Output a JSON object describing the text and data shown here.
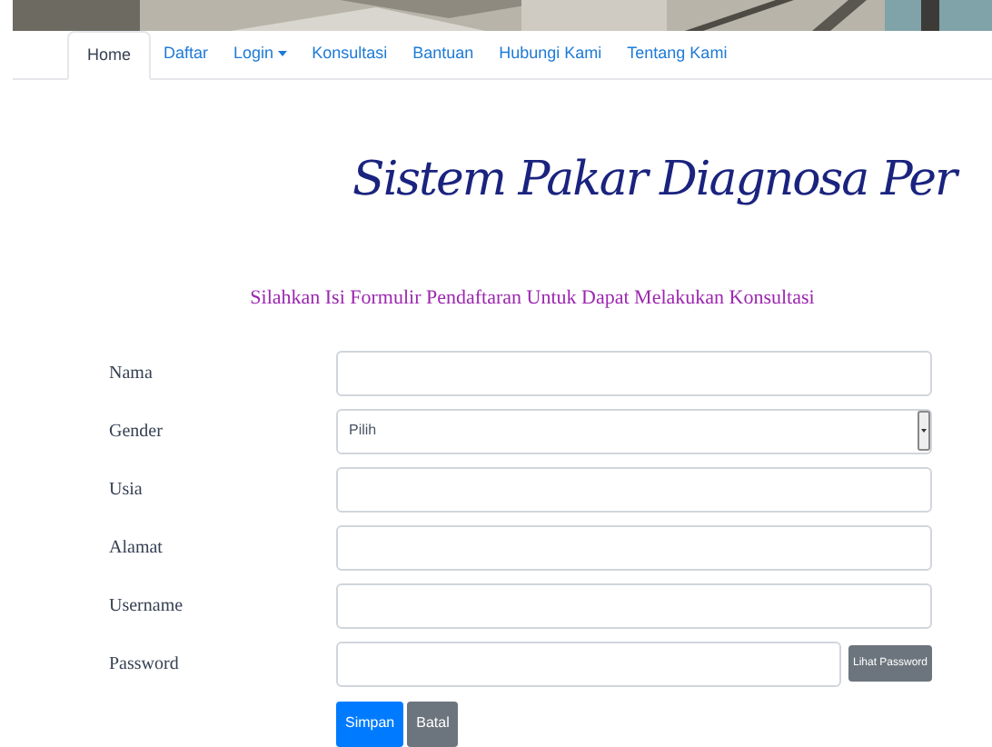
{
  "nav": [
    {
      "label": "Home",
      "selected": true,
      "dropdown": false
    },
    {
      "label": "Daftar",
      "selected": false,
      "dropdown": false
    },
    {
      "label": "Login",
      "selected": false,
      "dropdown": true
    },
    {
      "label": "Konsultasi",
      "selected": false,
      "dropdown": false
    },
    {
      "label": "Bantuan",
      "selected": false,
      "dropdown": false
    },
    {
      "label": "Hubungi Kami",
      "selected": false,
      "dropdown": false
    },
    {
      "label": "Tentang Kami",
      "selected": false,
      "dropdown": false
    }
  ],
  "title": "Sistem Pakar Diagnosa Per",
  "subtitle": "Silahkan Isi Formulir Pendaftaran Untuk Dapat Melakukan Konsultasi",
  "fields": [
    {
      "label": "Nama",
      "kind": "text"
    },
    {
      "label": "Gender",
      "kind": "select",
      "value": "Pilih"
    },
    {
      "label": "Usia",
      "kind": "text"
    },
    {
      "label": "Alamat",
      "kind": "text"
    },
    {
      "label": "Username",
      "kind": "text"
    },
    {
      "label": "Password",
      "kind": "password",
      "button": "Lihat Password"
    }
  ],
  "buttons": [
    {
      "label": "Simpan",
      "kind": "primary"
    },
    {
      "label": "Batal",
      "kind": "secondary"
    }
  ]
}
